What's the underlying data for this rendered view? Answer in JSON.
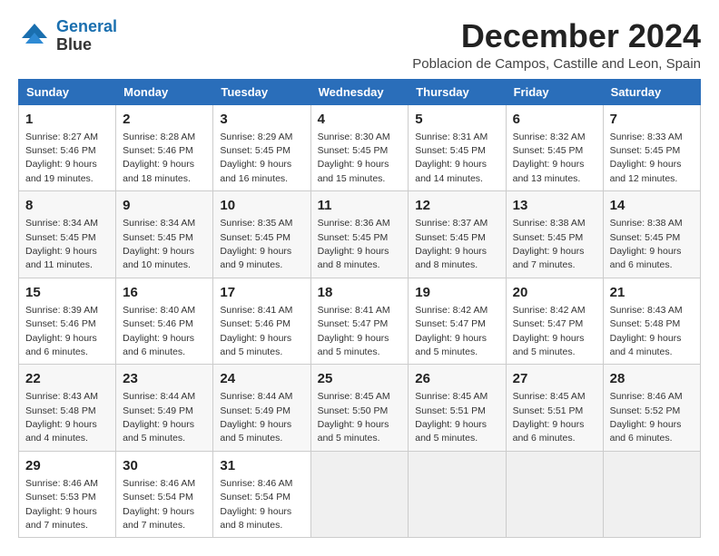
{
  "logo": {
    "line1": "General",
    "line2": "Blue"
  },
  "title": "December 2024",
  "location": "Poblacion de Campos, Castille and Leon, Spain",
  "headers": [
    "Sunday",
    "Monday",
    "Tuesday",
    "Wednesday",
    "Thursday",
    "Friday",
    "Saturday"
  ],
  "weeks": [
    [
      {
        "day": "1",
        "sunrise": "Sunrise: 8:27 AM",
        "sunset": "Sunset: 5:46 PM",
        "daylight": "Daylight: 9 hours and 19 minutes."
      },
      {
        "day": "2",
        "sunrise": "Sunrise: 8:28 AM",
        "sunset": "Sunset: 5:46 PM",
        "daylight": "Daylight: 9 hours and 18 minutes."
      },
      {
        "day": "3",
        "sunrise": "Sunrise: 8:29 AM",
        "sunset": "Sunset: 5:45 PM",
        "daylight": "Daylight: 9 hours and 16 minutes."
      },
      {
        "day": "4",
        "sunrise": "Sunrise: 8:30 AM",
        "sunset": "Sunset: 5:45 PM",
        "daylight": "Daylight: 9 hours and 15 minutes."
      },
      {
        "day": "5",
        "sunrise": "Sunrise: 8:31 AM",
        "sunset": "Sunset: 5:45 PM",
        "daylight": "Daylight: 9 hours and 14 minutes."
      },
      {
        "day": "6",
        "sunrise": "Sunrise: 8:32 AM",
        "sunset": "Sunset: 5:45 PM",
        "daylight": "Daylight: 9 hours and 13 minutes."
      },
      {
        "day": "7",
        "sunrise": "Sunrise: 8:33 AM",
        "sunset": "Sunset: 5:45 PM",
        "daylight": "Daylight: 9 hours and 12 minutes."
      }
    ],
    [
      {
        "day": "8",
        "sunrise": "Sunrise: 8:34 AM",
        "sunset": "Sunset: 5:45 PM",
        "daylight": "Daylight: 9 hours and 11 minutes."
      },
      {
        "day": "9",
        "sunrise": "Sunrise: 8:34 AM",
        "sunset": "Sunset: 5:45 PM",
        "daylight": "Daylight: 9 hours and 10 minutes."
      },
      {
        "day": "10",
        "sunrise": "Sunrise: 8:35 AM",
        "sunset": "Sunset: 5:45 PM",
        "daylight": "Daylight: 9 hours and 9 minutes."
      },
      {
        "day": "11",
        "sunrise": "Sunrise: 8:36 AM",
        "sunset": "Sunset: 5:45 PM",
        "daylight": "Daylight: 9 hours and 8 minutes."
      },
      {
        "day": "12",
        "sunrise": "Sunrise: 8:37 AM",
        "sunset": "Sunset: 5:45 PM",
        "daylight": "Daylight: 9 hours and 8 minutes."
      },
      {
        "day": "13",
        "sunrise": "Sunrise: 8:38 AM",
        "sunset": "Sunset: 5:45 PM",
        "daylight": "Daylight: 9 hours and 7 minutes."
      },
      {
        "day": "14",
        "sunrise": "Sunrise: 8:38 AM",
        "sunset": "Sunset: 5:45 PM",
        "daylight": "Daylight: 9 hours and 6 minutes."
      }
    ],
    [
      {
        "day": "15",
        "sunrise": "Sunrise: 8:39 AM",
        "sunset": "Sunset: 5:46 PM",
        "daylight": "Daylight: 9 hours and 6 minutes."
      },
      {
        "day": "16",
        "sunrise": "Sunrise: 8:40 AM",
        "sunset": "Sunset: 5:46 PM",
        "daylight": "Daylight: 9 hours and 6 minutes."
      },
      {
        "day": "17",
        "sunrise": "Sunrise: 8:41 AM",
        "sunset": "Sunset: 5:46 PM",
        "daylight": "Daylight: 9 hours and 5 minutes."
      },
      {
        "day": "18",
        "sunrise": "Sunrise: 8:41 AM",
        "sunset": "Sunset: 5:47 PM",
        "daylight": "Daylight: 9 hours and 5 minutes."
      },
      {
        "day": "19",
        "sunrise": "Sunrise: 8:42 AM",
        "sunset": "Sunset: 5:47 PM",
        "daylight": "Daylight: 9 hours and 5 minutes."
      },
      {
        "day": "20",
        "sunrise": "Sunrise: 8:42 AM",
        "sunset": "Sunset: 5:47 PM",
        "daylight": "Daylight: 9 hours and 5 minutes."
      },
      {
        "day": "21",
        "sunrise": "Sunrise: 8:43 AM",
        "sunset": "Sunset: 5:48 PM",
        "daylight": "Daylight: 9 hours and 4 minutes."
      }
    ],
    [
      {
        "day": "22",
        "sunrise": "Sunrise: 8:43 AM",
        "sunset": "Sunset: 5:48 PM",
        "daylight": "Daylight: 9 hours and 4 minutes."
      },
      {
        "day": "23",
        "sunrise": "Sunrise: 8:44 AM",
        "sunset": "Sunset: 5:49 PM",
        "daylight": "Daylight: 9 hours and 5 minutes."
      },
      {
        "day": "24",
        "sunrise": "Sunrise: 8:44 AM",
        "sunset": "Sunset: 5:49 PM",
        "daylight": "Daylight: 9 hours and 5 minutes."
      },
      {
        "day": "25",
        "sunrise": "Sunrise: 8:45 AM",
        "sunset": "Sunset: 5:50 PM",
        "daylight": "Daylight: 9 hours and 5 minutes."
      },
      {
        "day": "26",
        "sunrise": "Sunrise: 8:45 AM",
        "sunset": "Sunset: 5:51 PM",
        "daylight": "Daylight: 9 hours and 5 minutes."
      },
      {
        "day": "27",
        "sunrise": "Sunrise: 8:45 AM",
        "sunset": "Sunset: 5:51 PM",
        "daylight": "Daylight: 9 hours and 6 minutes."
      },
      {
        "day": "28",
        "sunrise": "Sunrise: 8:46 AM",
        "sunset": "Sunset: 5:52 PM",
        "daylight": "Daylight: 9 hours and 6 minutes."
      }
    ],
    [
      {
        "day": "29",
        "sunrise": "Sunrise: 8:46 AM",
        "sunset": "Sunset: 5:53 PM",
        "daylight": "Daylight: 9 hours and 7 minutes."
      },
      {
        "day": "30",
        "sunrise": "Sunrise: 8:46 AM",
        "sunset": "Sunset: 5:54 PM",
        "daylight": "Daylight: 9 hours and 7 minutes."
      },
      {
        "day": "31",
        "sunrise": "Sunrise: 8:46 AM",
        "sunset": "Sunset: 5:54 PM",
        "daylight": "Daylight: 9 hours and 8 minutes."
      },
      null,
      null,
      null,
      null
    ]
  ]
}
